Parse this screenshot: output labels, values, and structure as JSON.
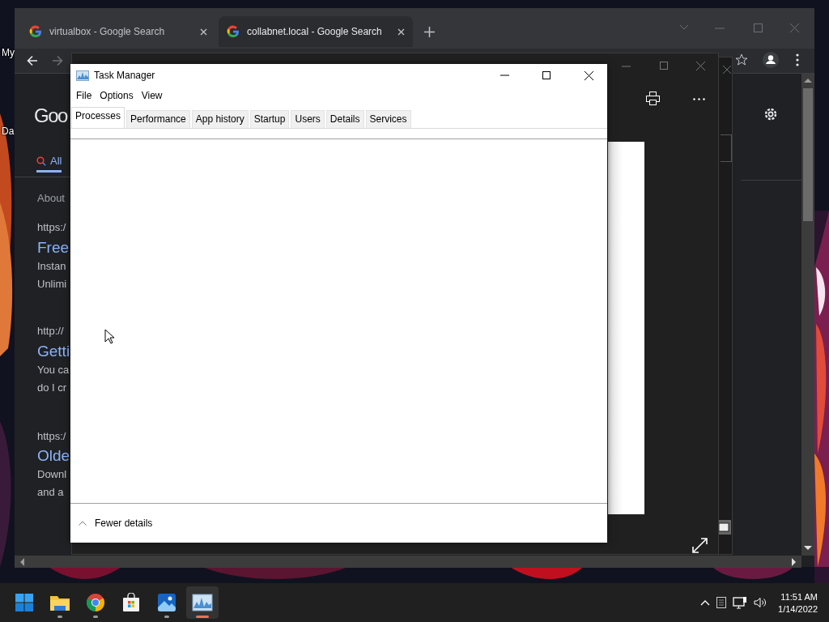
{
  "desktop_icons": [
    {
      "label": "My"
    },
    {
      "label": "Da"
    }
  ],
  "browser": {
    "tabs": [
      {
        "title": "virtualbox - Google Search",
        "selected": false
      },
      {
        "title": "collabnet.local - Google Search",
        "selected": true
      }
    ],
    "page": {
      "logo": "Goo",
      "search_tabs": [
        {
          "label": "All",
          "selected": true
        }
      ],
      "results_info": "About",
      "results": [
        {
          "url": "https:/",
          "title": "Free",
          "snippet": [
            "Instan",
            "Unlimi"
          ]
        },
        {
          "url": "http://",
          "title": "Getti",
          "snippet": [
            "You ca",
            "do I cr"
          ]
        },
        {
          "url": "https:/",
          "title": "Olde",
          "snippet": [
            "Downl",
            "and a"
          ]
        }
      ]
    }
  },
  "task_manager": {
    "title": "Task Manager",
    "menu": [
      "File",
      "Options",
      "View"
    ],
    "tabs": [
      {
        "label": "Processes",
        "selected": true
      },
      {
        "label": "Performance",
        "selected": false
      },
      {
        "label": "App history",
        "selected": false
      },
      {
        "label": "Startup",
        "selected": false
      },
      {
        "label": "Users",
        "selected": false
      },
      {
        "label": "Details",
        "selected": false
      },
      {
        "label": "Services",
        "selected": false
      }
    ],
    "footer": "Fewer details"
  },
  "taskbar": {
    "apps": [
      {
        "kind": "start",
        "running": false,
        "selected": false
      },
      {
        "kind": "files",
        "running": true,
        "selected": false
      },
      {
        "kind": "chrome",
        "running": true,
        "selected": false
      },
      {
        "kind": "store",
        "running": false,
        "selected": false
      },
      {
        "kind": "photos",
        "running": true,
        "selected": false
      },
      {
        "kind": "taskmgr",
        "running": true,
        "selected": true
      }
    ],
    "clock": {
      "time": "11:51 AM",
      "date": "1/14/2022"
    }
  }
}
